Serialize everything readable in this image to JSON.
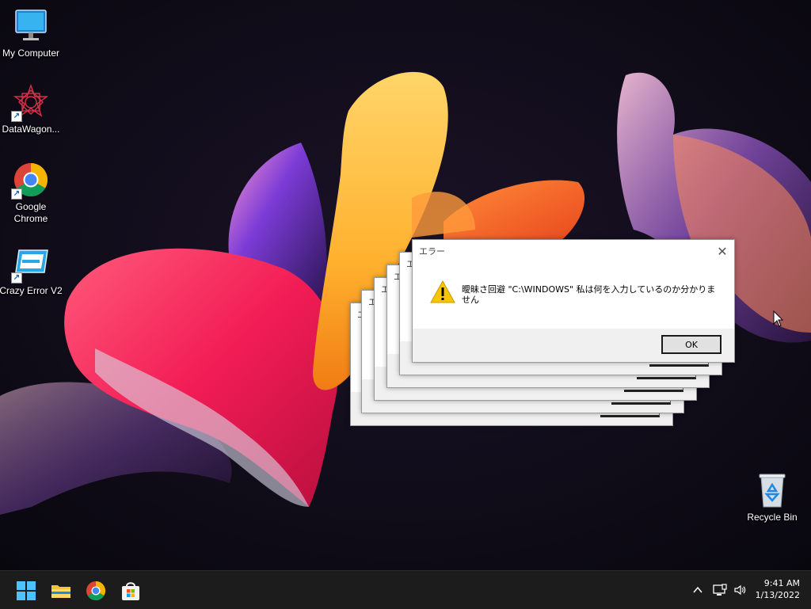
{
  "desktop": {
    "icons": [
      {
        "label": "My Computer",
        "icon": "monitor-icon"
      },
      {
        "label": "DataWagon...",
        "icon": "geometric-star-icon"
      },
      {
        "label": "Google Chrome",
        "icon": "chrome-icon"
      },
      {
        "label": "Crazy Error V2",
        "icon": "error-window-icon"
      },
      {
        "label": "Recycle Bin",
        "icon": "recycle-bin-icon"
      }
    ]
  },
  "stacked_dialog_titles": [
    "エ",
    "エ",
    "エ",
    "エ",
    "エ"
  ],
  "dialog": {
    "title": "エラー",
    "close_glyph": "✕",
    "icon": "warning-icon",
    "message": "曖昧さ回避 \"C:\\WINDOWS\" 私は何を入力しているのか分かりません",
    "ok_label": "OK"
  },
  "taskbar": {
    "items": [
      "start-icon",
      "file-explorer-icon",
      "chrome-icon",
      "store-icon"
    ],
    "tray": [
      "chevron-up-icon",
      "network-icon",
      "volume-icon"
    ],
    "time": "9:41 AM",
    "date": "1/13/2022"
  },
  "colors": {
    "background": "#0c0a14",
    "taskbar": "#1c1c1c",
    "accent": "#0078d4"
  }
}
